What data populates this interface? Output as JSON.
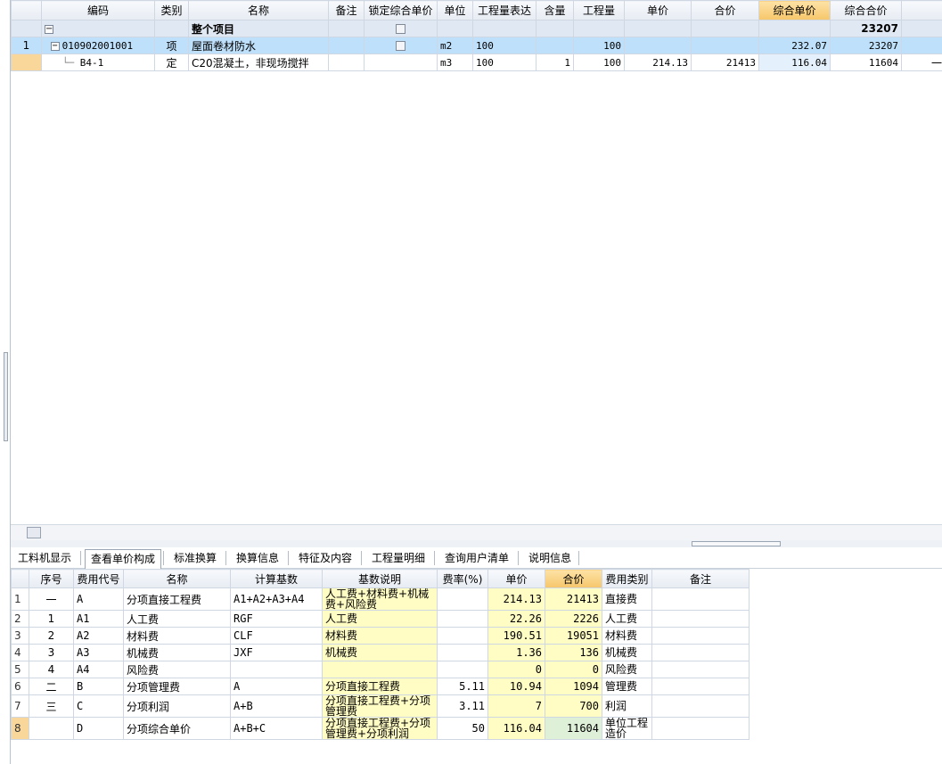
{
  "top_grid": {
    "headers": [
      "编码",
      "类别",
      "名称",
      "备注",
      "锁定综合单价",
      "单位",
      "工程量表达",
      "含量",
      "工程量",
      "单价",
      "合价",
      "综合单价",
      "综合合价"
    ],
    "total_row": {
      "name": "整个项目",
      "total": "23207"
    },
    "item_row": {
      "index": "1",
      "code": "010902001001",
      "type": "项",
      "name": "屋面卷材防水",
      "unit": "m2",
      "expr": "100",
      "qty": "100",
      "unit_comp_price": "232.07",
      "total_comp_price": "23207",
      "extra": "—"
    },
    "sub_row": {
      "code": "B4-1",
      "type": "定",
      "name": "C20混凝土，非现场搅拌",
      "unit": "m3",
      "expr": "100",
      "content": "1",
      "qty": "100",
      "price": "214.13",
      "amount": "21413",
      "unit_comp_price": "116.04",
      "total_comp_price": "11604",
      "extra": "一般"
    }
  },
  "tabs": [
    "工料机显示",
    "查看单价构成",
    "标准换算",
    "换算信息",
    "特征及内容",
    "工程量明细",
    "查询用户清单",
    "说明信息"
  ],
  "active_tab": "查看单价构成",
  "bottom_grid": {
    "headers": [
      "序号",
      "费用代号",
      "名称",
      "计算基数",
      "基数说明",
      "费率(%)",
      "单价",
      "合价",
      "费用类别",
      "备注"
    ],
    "rows": [
      {
        "n": "1",
        "seq": "一",
        "code": "A",
        "name": "分项直接工程费",
        "base": "A1+A2+A3+A4",
        "desc": "人工费+材料费+机械费+风险费",
        "rate": "",
        "price": "214.13",
        "amount": "21413",
        "cat": "直接费",
        "note": ""
      },
      {
        "n": "2",
        "seq": "1",
        "code": "A1",
        "name": "人工费",
        "base": "RGF",
        "desc": "人工费",
        "rate": "",
        "price": "22.26",
        "amount": "2226",
        "cat": "人工费",
        "note": ""
      },
      {
        "n": "3",
        "seq": "2",
        "code": "A2",
        "name": "材料费",
        "base": "CLF",
        "desc": "材料费",
        "rate": "",
        "price": "190.51",
        "amount": "19051",
        "cat": "材料费",
        "note": ""
      },
      {
        "n": "4",
        "seq": "3",
        "code": "A3",
        "name": "机械费",
        "base": "JXF",
        "desc": "机械费",
        "rate": "",
        "price": "1.36",
        "amount": "136",
        "cat": "机械费",
        "note": ""
      },
      {
        "n": "5",
        "seq": "4",
        "code": "A4",
        "name": "风险费",
        "base": "",
        "desc": "",
        "rate": "",
        "price": "0",
        "amount": "0",
        "cat": "风险费",
        "note": ""
      },
      {
        "n": "6",
        "seq": "二",
        "code": "B",
        "name": "分项管理费",
        "base": "A",
        "desc": "分项直接工程费",
        "rate": "5.11",
        "price": "10.94",
        "amount": "1094",
        "cat": "管理费",
        "note": ""
      },
      {
        "n": "7",
        "seq": "三",
        "code": "C",
        "name": "分项利润",
        "base": "A+B",
        "desc": "分项直接工程费+分项管理费",
        "rate": "3.11",
        "price": "7",
        "amount": "700",
        "cat": "利润",
        "note": ""
      },
      {
        "n": "8",
        "seq": "",
        "code": "D",
        "name": "分项综合单价",
        "base": "A+B+C",
        "desc": "分项直接工程费+分项管理费+分项利润",
        "rate": "50",
        "price": "116.04",
        "amount": "11604",
        "cat": "单位工程造价",
        "note": ""
      }
    ]
  }
}
